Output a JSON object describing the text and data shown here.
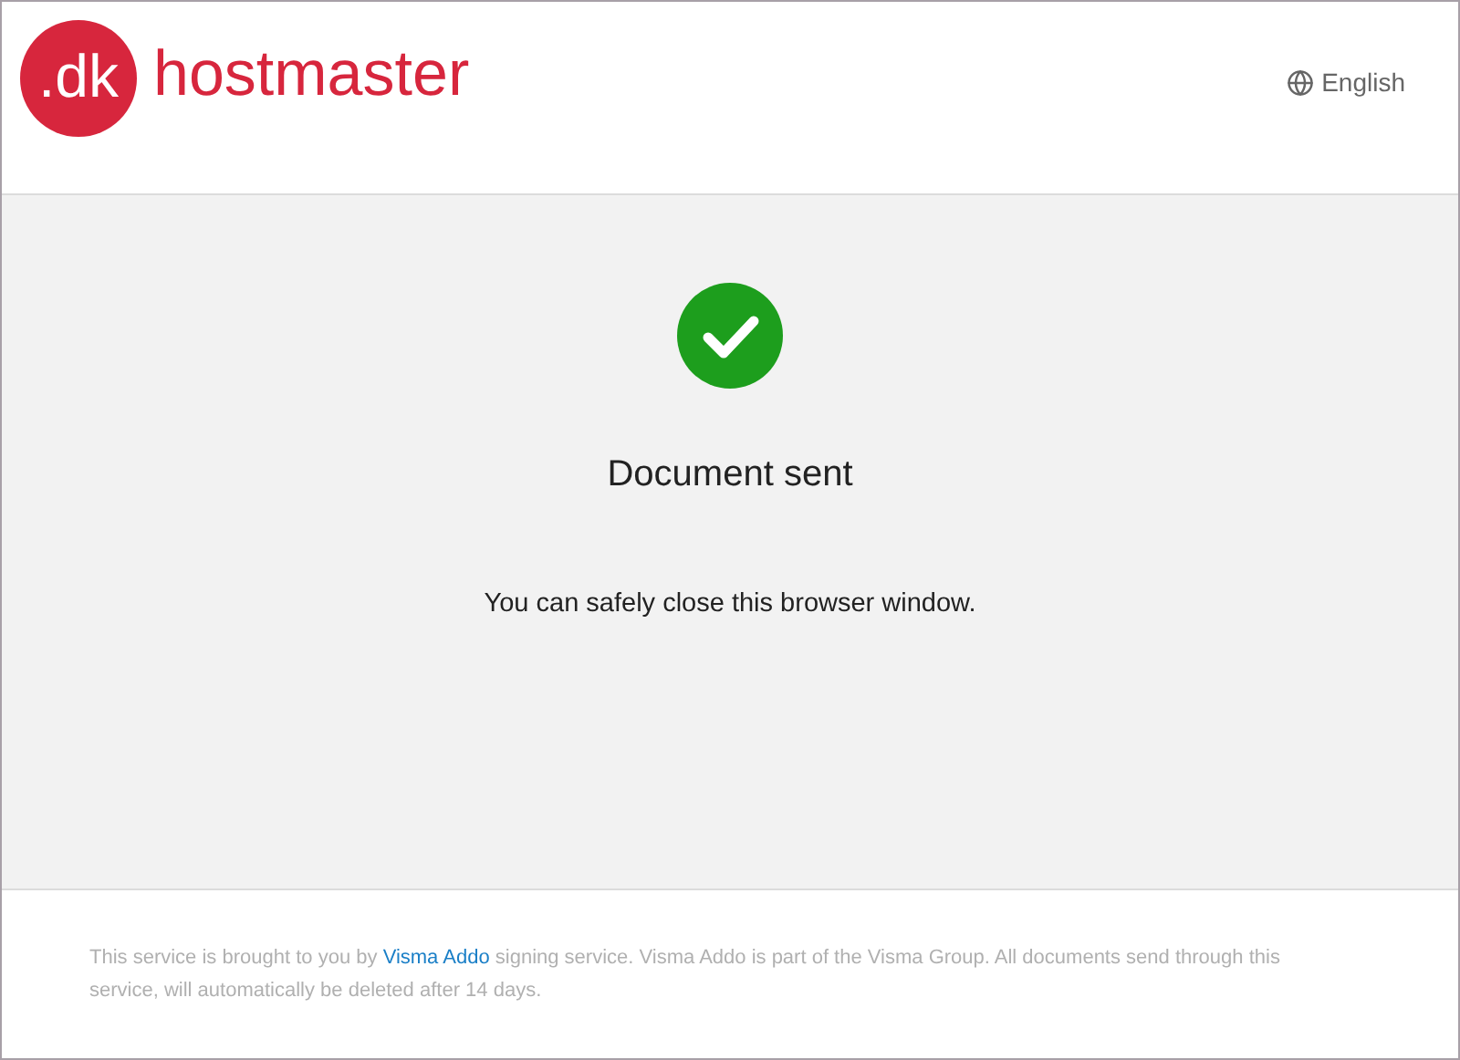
{
  "header": {
    "logo_badge": ".dk",
    "logo_text": "hostmaster",
    "language": "English"
  },
  "status": {
    "title": "Document sent",
    "message": "You can safely close this browser window."
  },
  "footer": {
    "text_before": "This service is brought to you by",
    "link": "Visma Addo",
    "text_after": "signing service. Visma Addo is part of the Visma Group. All documents send through this service, will automatically be deleted after 14 days."
  }
}
